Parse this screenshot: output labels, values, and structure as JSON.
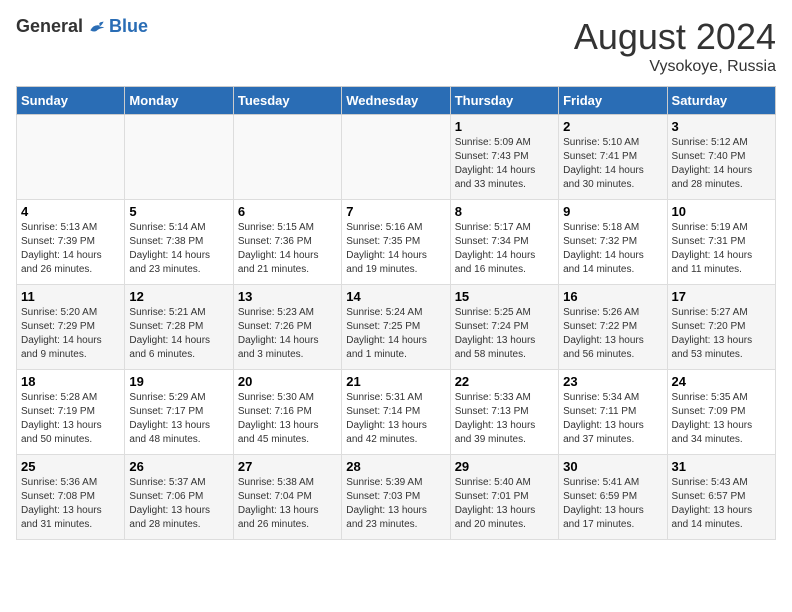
{
  "header": {
    "logo_general": "General",
    "logo_blue": "Blue",
    "month_year": "August 2024",
    "location": "Vysokoye, Russia"
  },
  "weekdays": [
    "Sunday",
    "Monday",
    "Tuesday",
    "Wednesday",
    "Thursday",
    "Friday",
    "Saturday"
  ],
  "weeks": [
    [
      {
        "day": "",
        "sunrise": "",
        "sunset": "",
        "daylight": ""
      },
      {
        "day": "",
        "sunrise": "",
        "sunset": "",
        "daylight": ""
      },
      {
        "day": "",
        "sunrise": "",
        "sunset": "",
        "daylight": ""
      },
      {
        "day": "",
        "sunrise": "",
        "sunset": "",
        "daylight": ""
      },
      {
        "day": "1",
        "sunrise": "Sunrise: 5:09 AM",
        "sunset": "Sunset: 7:43 PM",
        "daylight": "Daylight: 14 hours and 33 minutes."
      },
      {
        "day": "2",
        "sunrise": "Sunrise: 5:10 AM",
        "sunset": "Sunset: 7:41 PM",
        "daylight": "Daylight: 14 hours and 30 minutes."
      },
      {
        "day": "3",
        "sunrise": "Sunrise: 5:12 AM",
        "sunset": "Sunset: 7:40 PM",
        "daylight": "Daylight: 14 hours and 28 minutes."
      }
    ],
    [
      {
        "day": "4",
        "sunrise": "Sunrise: 5:13 AM",
        "sunset": "Sunset: 7:39 PM",
        "daylight": "Daylight: 14 hours and 26 minutes."
      },
      {
        "day": "5",
        "sunrise": "Sunrise: 5:14 AM",
        "sunset": "Sunset: 7:38 PM",
        "daylight": "Daylight: 14 hours and 23 minutes."
      },
      {
        "day": "6",
        "sunrise": "Sunrise: 5:15 AM",
        "sunset": "Sunset: 7:36 PM",
        "daylight": "Daylight: 14 hours and 21 minutes."
      },
      {
        "day": "7",
        "sunrise": "Sunrise: 5:16 AM",
        "sunset": "Sunset: 7:35 PM",
        "daylight": "Daylight: 14 hours and 19 minutes."
      },
      {
        "day": "8",
        "sunrise": "Sunrise: 5:17 AM",
        "sunset": "Sunset: 7:34 PM",
        "daylight": "Daylight: 14 hours and 16 minutes."
      },
      {
        "day": "9",
        "sunrise": "Sunrise: 5:18 AM",
        "sunset": "Sunset: 7:32 PM",
        "daylight": "Daylight: 14 hours and 14 minutes."
      },
      {
        "day": "10",
        "sunrise": "Sunrise: 5:19 AM",
        "sunset": "Sunset: 7:31 PM",
        "daylight": "Daylight: 14 hours and 11 minutes."
      }
    ],
    [
      {
        "day": "11",
        "sunrise": "Sunrise: 5:20 AM",
        "sunset": "Sunset: 7:29 PM",
        "daylight": "Daylight: 14 hours and 9 minutes."
      },
      {
        "day": "12",
        "sunrise": "Sunrise: 5:21 AM",
        "sunset": "Sunset: 7:28 PM",
        "daylight": "Daylight: 14 hours and 6 minutes."
      },
      {
        "day": "13",
        "sunrise": "Sunrise: 5:23 AM",
        "sunset": "Sunset: 7:26 PM",
        "daylight": "Daylight: 14 hours and 3 minutes."
      },
      {
        "day": "14",
        "sunrise": "Sunrise: 5:24 AM",
        "sunset": "Sunset: 7:25 PM",
        "daylight": "Daylight: 14 hours and 1 minute."
      },
      {
        "day": "15",
        "sunrise": "Sunrise: 5:25 AM",
        "sunset": "Sunset: 7:24 PM",
        "daylight": "Daylight: 13 hours and 58 minutes."
      },
      {
        "day": "16",
        "sunrise": "Sunrise: 5:26 AM",
        "sunset": "Sunset: 7:22 PM",
        "daylight": "Daylight: 13 hours and 56 minutes."
      },
      {
        "day": "17",
        "sunrise": "Sunrise: 5:27 AM",
        "sunset": "Sunset: 7:20 PM",
        "daylight": "Daylight: 13 hours and 53 minutes."
      }
    ],
    [
      {
        "day": "18",
        "sunrise": "Sunrise: 5:28 AM",
        "sunset": "Sunset: 7:19 PM",
        "daylight": "Daylight: 13 hours and 50 minutes."
      },
      {
        "day": "19",
        "sunrise": "Sunrise: 5:29 AM",
        "sunset": "Sunset: 7:17 PM",
        "daylight": "Daylight: 13 hours and 48 minutes."
      },
      {
        "day": "20",
        "sunrise": "Sunrise: 5:30 AM",
        "sunset": "Sunset: 7:16 PM",
        "daylight": "Daylight: 13 hours and 45 minutes."
      },
      {
        "day": "21",
        "sunrise": "Sunrise: 5:31 AM",
        "sunset": "Sunset: 7:14 PM",
        "daylight": "Daylight: 13 hours and 42 minutes."
      },
      {
        "day": "22",
        "sunrise": "Sunrise: 5:33 AM",
        "sunset": "Sunset: 7:13 PM",
        "daylight": "Daylight: 13 hours and 39 minutes."
      },
      {
        "day": "23",
        "sunrise": "Sunrise: 5:34 AM",
        "sunset": "Sunset: 7:11 PM",
        "daylight": "Daylight: 13 hours and 37 minutes."
      },
      {
        "day": "24",
        "sunrise": "Sunrise: 5:35 AM",
        "sunset": "Sunset: 7:09 PM",
        "daylight": "Daylight: 13 hours and 34 minutes."
      }
    ],
    [
      {
        "day": "25",
        "sunrise": "Sunrise: 5:36 AM",
        "sunset": "Sunset: 7:08 PM",
        "daylight": "Daylight: 13 hours and 31 minutes."
      },
      {
        "day": "26",
        "sunrise": "Sunrise: 5:37 AM",
        "sunset": "Sunset: 7:06 PM",
        "daylight": "Daylight: 13 hours and 28 minutes."
      },
      {
        "day": "27",
        "sunrise": "Sunrise: 5:38 AM",
        "sunset": "Sunset: 7:04 PM",
        "daylight": "Daylight: 13 hours and 26 minutes."
      },
      {
        "day": "28",
        "sunrise": "Sunrise: 5:39 AM",
        "sunset": "Sunset: 7:03 PM",
        "daylight": "Daylight: 13 hours and 23 minutes."
      },
      {
        "day": "29",
        "sunrise": "Sunrise: 5:40 AM",
        "sunset": "Sunset: 7:01 PM",
        "daylight": "Daylight: 13 hours and 20 minutes."
      },
      {
        "day": "30",
        "sunrise": "Sunrise: 5:41 AM",
        "sunset": "Sunset: 6:59 PM",
        "daylight": "Daylight: 13 hours and 17 minutes."
      },
      {
        "day": "31",
        "sunrise": "Sunrise: 5:43 AM",
        "sunset": "Sunset: 6:57 PM",
        "daylight": "Daylight: 13 hours and 14 minutes."
      }
    ]
  ]
}
